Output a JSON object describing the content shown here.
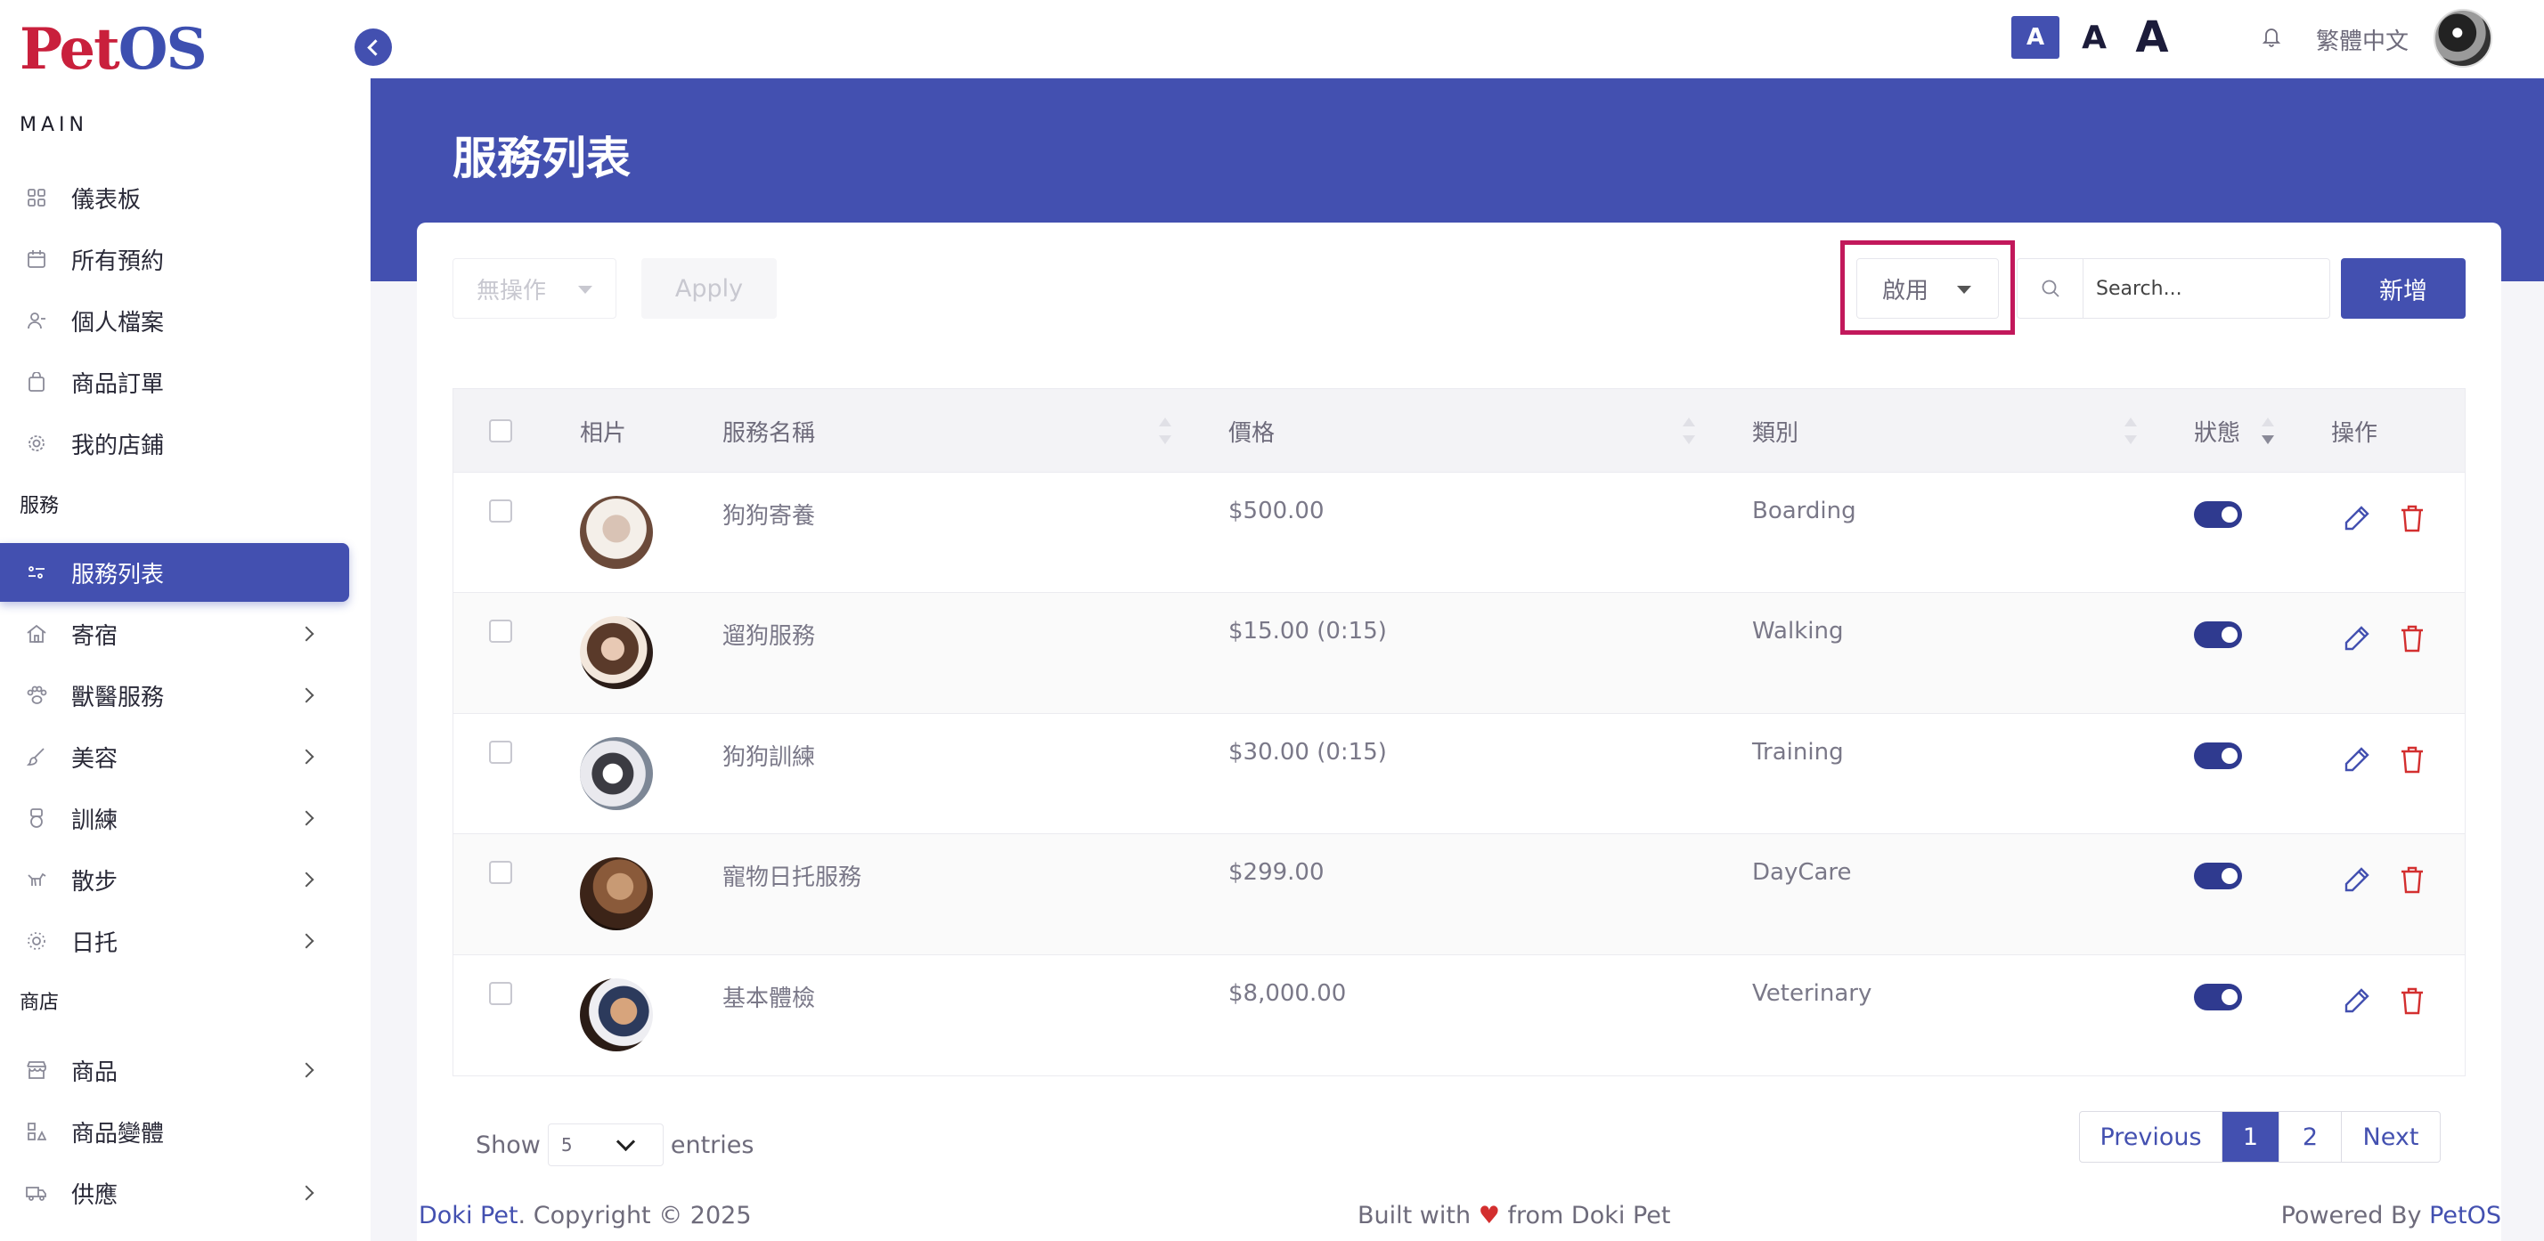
{
  "logo": {
    "part1": "Pet",
    "part2": "OS"
  },
  "sidebar": {
    "section_main": "MAIN",
    "main_items": [
      {
        "label": "儀表板",
        "icon": "grid-icon"
      },
      {
        "label": "所有預約",
        "icon": "calendar-icon"
      },
      {
        "label": "個人檔案",
        "icon": "user-icon"
      },
      {
        "label": "商品訂單",
        "icon": "bag-icon"
      },
      {
        "label": "我的店鋪",
        "icon": "store-gear-icon"
      }
    ],
    "section_service": "服務",
    "service_items": [
      {
        "label": "服務列表",
        "icon": "sliders-icon",
        "active": true
      },
      {
        "label": "寄宿",
        "icon": "home-icon"
      },
      {
        "label": "獸醫服務",
        "icon": "paw-icon"
      },
      {
        "label": "美容",
        "icon": "brush-icon"
      },
      {
        "label": "訓練",
        "icon": "medal-icon"
      },
      {
        "label": "散步",
        "icon": "dog-walk-icon"
      },
      {
        "label": "日托",
        "icon": "sun-icon"
      }
    ],
    "section_shop": "商店",
    "shop_items": [
      {
        "label": "商品",
        "icon": "shop-icon"
      },
      {
        "label": "商品變體",
        "icon": "variants-icon"
      },
      {
        "label": "供應",
        "icon": "truck-icon"
      }
    ]
  },
  "topbar": {
    "font_small": "A",
    "font_medium": "A",
    "font_large": "A",
    "language": "繁體中文"
  },
  "page": {
    "title": "服務列表"
  },
  "toolbar": {
    "bulk_action": "無操作",
    "apply_label": "Apply",
    "status_filter": "啟用",
    "search_placeholder": "Search...",
    "add_label": "新增"
  },
  "table": {
    "headers": {
      "photo": "相片",
      "name": "服務名稱",
      "price": "價格",
      "category": "類別",
      "status": "狀態",
      "actions": "操作"
    },
    "rows": [
      {
        "name": "狗狗寄養",
        "price": "$500.00",
        "category": "Boarding",
        "enabled": true
      },
      {
        "name": "遛狗服務",
        "price": "$15.00 (0:15)",
        "category": "Walking",
        "enabled": true
      },
      {
        "name": "狗狗訓練",
        "price": "$30.00 (0:15)",
        "category": "Training",
        "enabled": true
      },
      {
        "name": "寵物日托服務",
        "price": "$299.00",
        "category": "DayCare",
        "enabled": true
      },
      {
        "name": "基本體檢",
        "price": "$8,000.00",
        "category": "Veterinary",
        "enabled": true
      }
    ]
  },
  "pagination": {
    "show_label": "Show",
    "entries_value": "5",
    "entries_label": "entries",
    "previous": "Previous",
    "page1": "1",
    "page2": "2",
    "next": "Next"
  },
  "footer": {
    "brand": "Doki Pet",
    "copyright": ". Copyright © 2025",
    "built_pre": "Built with",
    "heart": "♥",
    "built_post": "from Doki Pet",
    "powered_pre": "Powered By",
    "powered_brand": "PetOS"
  },
  "colors": {
    "primary": "#4350b0",
    "logo_red": "#c9203c",
    "highlight": "#c2185b",
    "delete": "#d32f2f"
  }
}
